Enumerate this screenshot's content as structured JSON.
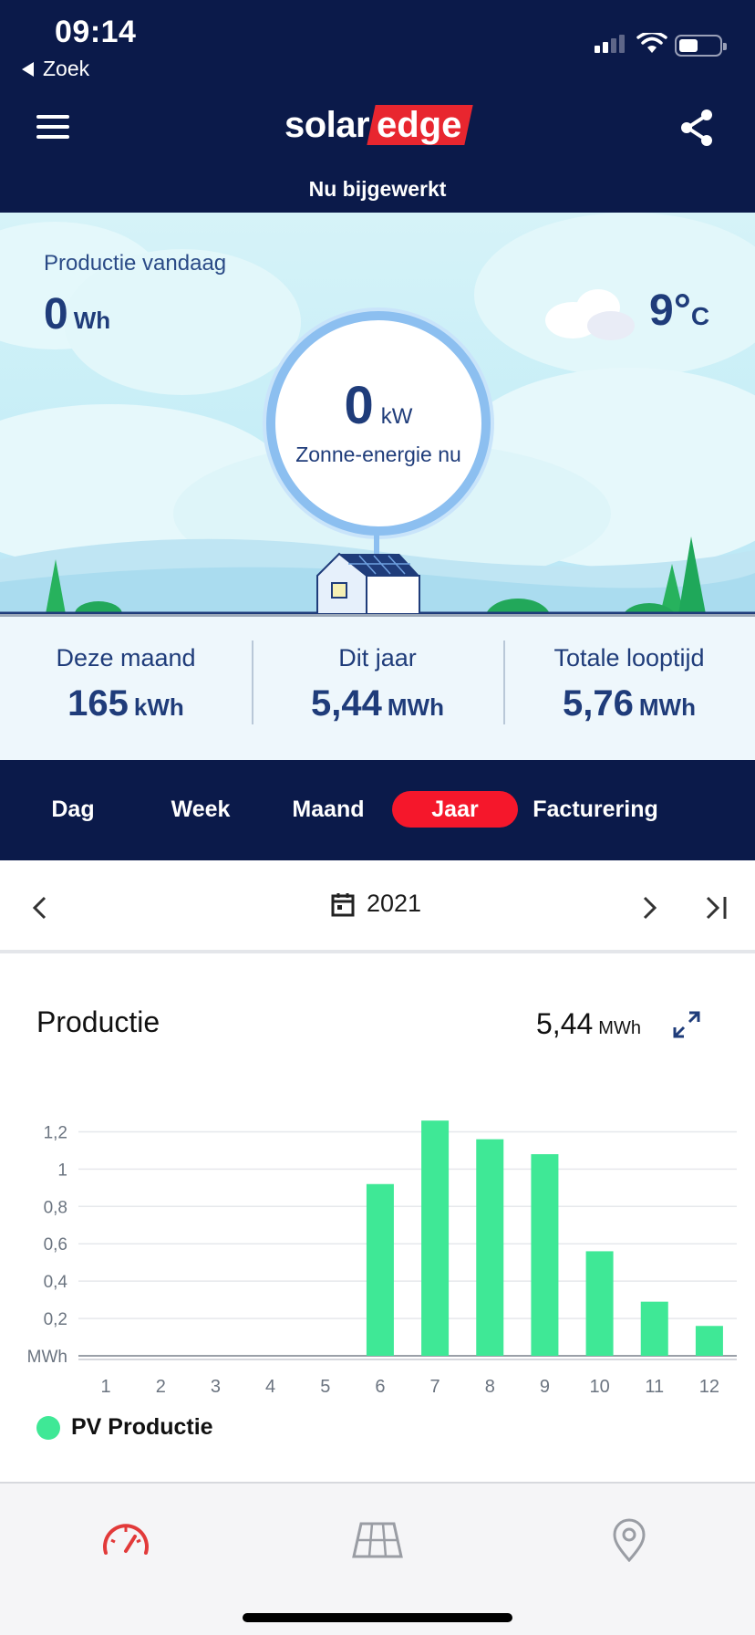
{
  "status_bar": {
    "time": "09:14",
    "back_label": "Zoek"
  },
  "header": {
    "logo_part1": "solar",
    "logo_part2": "edge",
    "updated_text": "Nu bijgewerkt"
  },
  "hero": {
    "production_today_label": "Productie vandaag",
    "production_today_value": "0",
    "production_today_unit": "Wh",
    "temperature_value": "9°",
    "temperature_unit": "C",
    "weather_icon": "cloud-icon",
    "solar_now_value": "0",
    "solar_now_unit": "kW",
    "solar_now_label": "Zonne-energie nu"
  },
  "stats": [
    {
      "label": "Deze maand",
      "value": "165",
      "unit": "kWh"
    },
    {
      "label": "Dit jaar",
      "value": "5,44",
      "unit": "MWh"
    },
    {
      "label": "Totale looptijd",
      "value": "5,76",
      "unit": "MWh"
    }
  ],
  "tabs": [
    {
      "label": "Dag",
      "active": false
    },
    {
      "label": "Week",
      "active": false
    },
    {
      "label": "Maand",
      "active": false
    },
    {
      "label": "Jaar",
      "active": true
    },
    {
      "label": "Facturering",
      "active": false
    }
  ],
  "period": {
    "label": "2021",
    "icons": [
      "chevron-left-icon",
      "calendar-icon",
      "chevron-right-icon",
      "skip-to-end-icon"
    ]
  },
  "card": {
    "title": "Productie",
    "total_value": "5,44",
    "total_unit": "MWh"
  },
  "chart_data": {
    "type": "bar",
    "categories": [
      "1",
      "2",
      "3",
      "4",
      "5",
      "6",
      "7",
      "8",
      "9",
      "10",
      "11",
      "12"
    ],
    "series": [
      {
        "name": "PV Productie",
        "values": [
          0,
          0,
          0,
          0,
          0,
          0.92,
          1.26,
          1.16,
          1.08,
          0.56,
          0.29,
          0.16
        ]
      }
    ],
    "yticks": [
      "MWh",
      "0,2",
      "0,4",
      "0,6",
      "0,8",
      "1",
      "1,2"
    ],
    "ylabel": "MWh",
    "ylim": [
      0,
      1.3
    ],
    "grid": true,
    "legend_position": "bottom-left",
    "color": "#3fe896"
  },
  "legend": {
    "label": "PV Productie"
  },
  "bottom_nav": [
    {
      "icon": "speedometer-icon",
      "active": true
    },
    {
      "icon": "solar-panel-icon",
      "active": false
    },
    {
      "icon": "location-pin-icon",
      "active": false
    }
  ],
  "colors": {
    "navy": "#0b1a4a",
    "accent_red": "#f5172b",
    "bar_green": "#3fe896",
    "text_blue": "#1f3c7a"
  }
}
